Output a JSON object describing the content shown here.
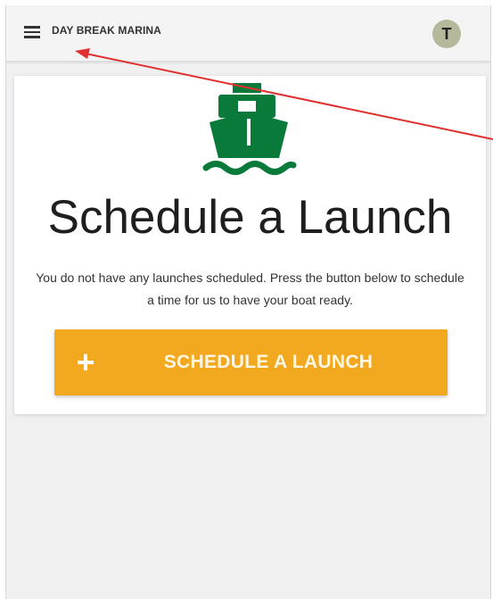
{
  "app": {
    "title": "DAY BREAK MARINA",
    "avatar_initial": "T",
    "menu_icon": "hamburger-menu-icon"
  },
  "card": {
    "icon": "boat-icon",
    "heading": "Schedule a Launch",
    "description": "You do not have any launches scheduled. Press the button below to schedule a time for us to have your boat ready.",
    "button": {
      "icon": "plus-icon",
      "icon_glyph": "+",
      "label": "SCHEDULE A LAUNCH"
    }
  },
  "annotation": {
    "type": "arrow",
    "color": "#e03030",
    "points_to": "app-title"
  },
  "colors": {
    "brand_green": "#0a7a3b",
    "button_orange": "#f3a91f",
    "avatar_bg": "#b5b89a",
    "app_background": "#f0f0f1"
  }
}
